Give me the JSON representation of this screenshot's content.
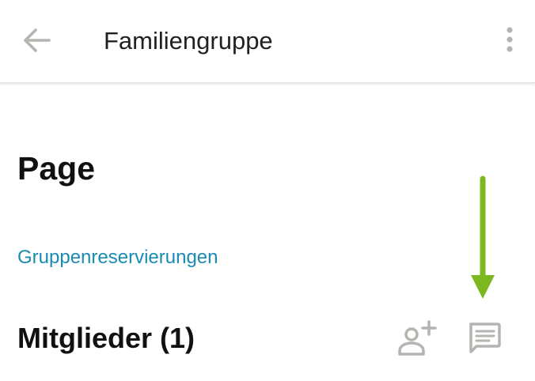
{
  "app_bar": {
    "title": "Familiengruppe",
    "back_icon": "arrow-back-icon",
    "overflow_icon": "more-vert-icon"
  },
  "main": {
    "page_heading": "Page",
    "group_reservations_link": "Gruppenreservierungen",
    "members_heading": "Mitglieder (1)",
    "add_member_icon": "person-add-icon",
    "chat_icon": "chat-icon"
  },
  "colors": {
    "link": "#1a8bb3",
    "icon_gray": "#b4b4b0",
    "annotation_arrow": "#7db91e"
  }
}
